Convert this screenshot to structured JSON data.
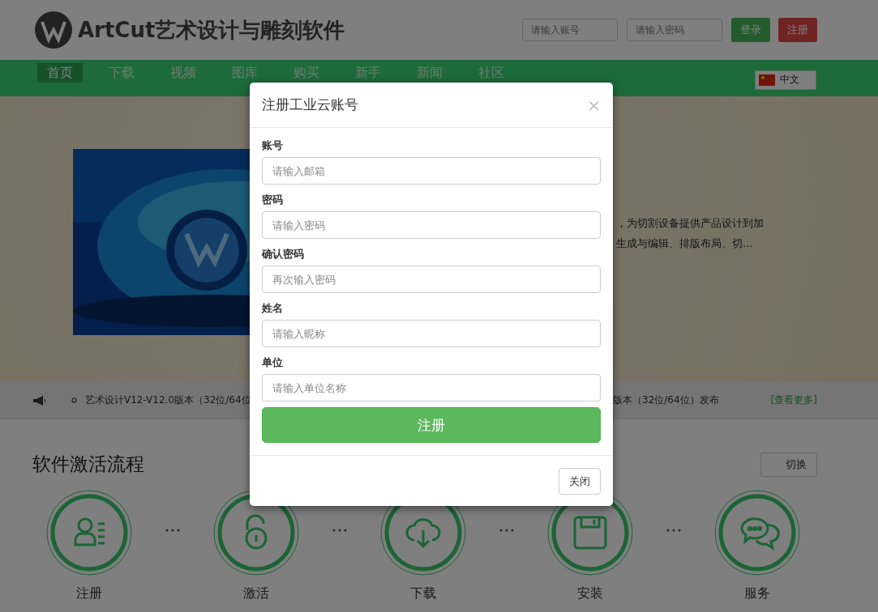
{
  "header": {
    "logo_text": "ArtCut艺术设计与雕刻软件",
    "account_placeholder": "请输入账号",
    "password_placeholder": "请输入密码",
    "login_button": "登录",
    "register_button": "注册"
  },
  "nav": {
    "items": [
      {
        "label": "首页",
        "selected": true
      },
      {
        "label": "下载",
        "selected": false
      },
      {
        "label": "视频",
        "selected": false
      },
      {
        "label": "图库",
        "selected": false
      },
      {
        "label": "购买",
        "selected": false
      },
      {
        "label": "新手",
        "selected": false
      },
      {
        "label": "新闻",
        "selected": false
      },
      {
        "label": "社区",
        "selected": false
      }
    ],
    "language": "中文"
  },
  "hero": {
    "description": [
      "，为切割设备提供产品设计到加",
      "生成与编辑、排版布局、切..."
    ]
  },
  "notice": {
    "left_item": "艺术设计V12-V12.0版本（32位/64位",
    "right_item": "版本（32位/64位）发布",
    "more_link": "[查看更多]"
  },
  "activation": {
    "title": "软件激活流程",
    "switch_button": "切换",
    "steps": [
      {
        "label": "注册",
        "kind": "person"
      },
      {
        "label": "激活",
        "kind": "unlock"
      },
      {
        "label": "下载",
        "kind": "download"
      },
      {
        "label": "安装",
        "kind": "disk"
      },
      {
        "label": "服务",
        "kind": "chat"
      }
    ]
  },
  "modal": {
    "title": "注册工业云账号",
    "close_icon": "×",
    "fields": [
      {
        "label": "账号",
        "placeholder": "请输入邮箱"
      },
      {
        "label": "密码",
        "placeholder": "请输入密码"
      },
      {
        "label": "确认密码",
        "placeholder": "再次输入密码"
      },
      {
        "label": "姓名",
        "placeholder": "请输入昵称"
      },
      {
        "label": "单位",
        "placeholder": "请输入单位名称"
      }
    ],
    "submit_button": "注册",
    "close_button": "关闭"
  }
}
